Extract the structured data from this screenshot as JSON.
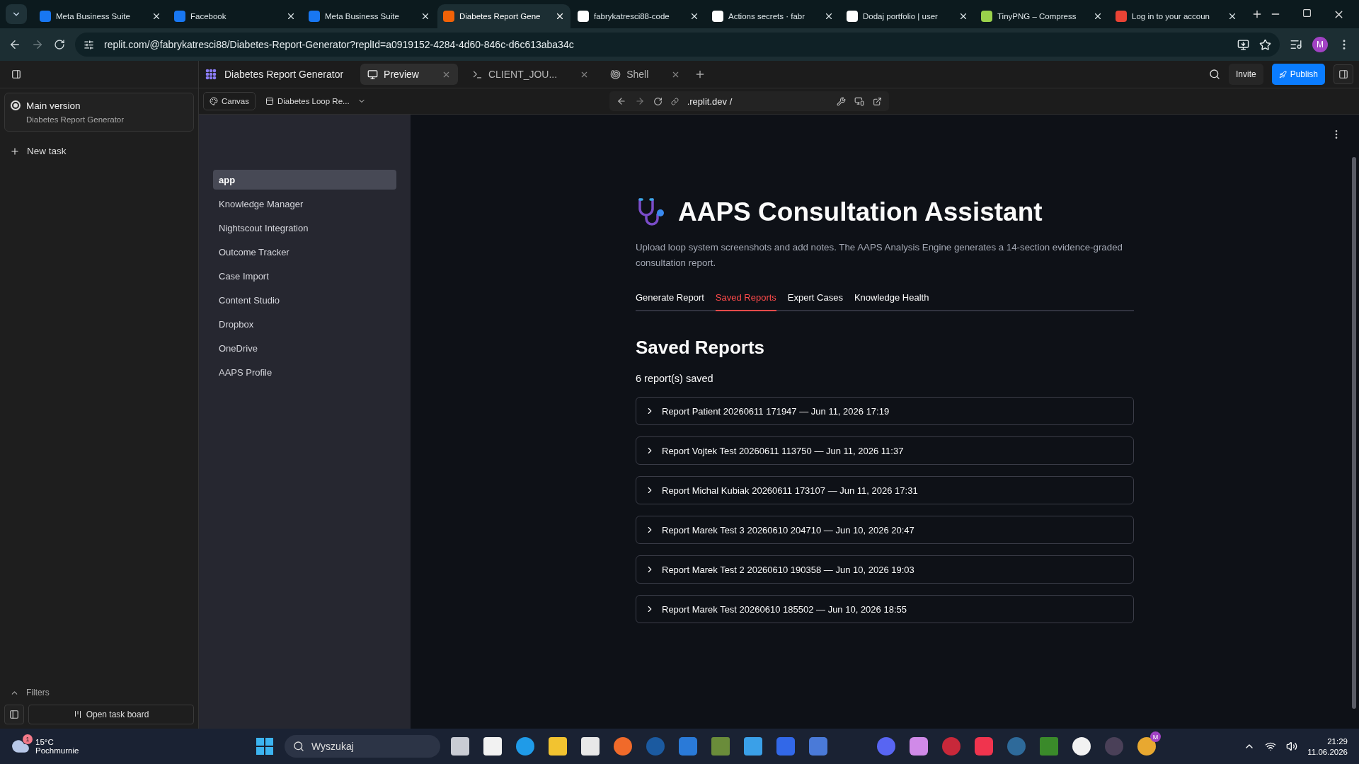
{
  "browser": {
    "tabs": [
      {
        "title": "Meta Business Suite",
        "selected": false
      },
      {
        "title": "Facebook",
        "selected": false
      },
      {
        "title": "Meta Business Suite",
        "selected": false
      },
      {
        "title": "Diabetes Report Gene",
        "selected": true
      },
      {
        "title": "fabrykatresci88-code",
        "selected": false
      },
      {
        "title": "Actions secrets · fabr",
        "selected": false
      },
      {
        "title": "Dodaj portfolio | user",
        "selected": false
      },
      {
        "title": "TinyPNG – Compress",
        "selected": false
      },
      {
        "title": "Log in to your accoun",
        "selected": false
      }
    ],
    "url": "replit.com/@fabrykatresci88/Diabetes-Report-Generator?replId=a0919152-4284-4d60-846c-d6c613aba34c",
    "profile": "M"
  },
  "replit": {
    "project": "Diabetes Report Generator",
    "tabs": [
      {
        "label": "Preview",
        "selected": true
      },
      {
        "label": "CLIENT_JOU...",
        "selected": false
      },
      {
        "label": "Shell",
        "selected": false
      }
    ],
    "invite": "Invite",
    "publish": "Publish",
    "canvas": "Canvas",
    "workflow": "Diabetes Loop Re...",
    "preview_url": ".replit.dev /",
    "version": {
      "title": "Main version",
      "subtitle": "Diabetes Report Generator"
    },
    "new_task": "New task",
    "filters": "Filters",
    "task_board": "Open task board"
  },
  "sidebar": {
    "items": [
      {
        "label": "app",
        "selected": true
      },
      {
        "label": "Knowledge Manager",
        "selected": false
      },
      {
        "label": "Nightscout Integration",
        "selected": false
      },
      {
        "label": "Outcome Tracker",
        "selected": false
      },
      {
        "label": "Case Import",
        "selected": false
      },
      {
        "label": "Content Studio",
        "selected": false
      },
      {
        "label": "Dropbox",
        "selected": false
      },
      {
        "label": "OneDrive",
        "selected": false
      },
      {
        "label": "AAPS Profile",
        "selected": false
      }
    ]
  },
  "app": {
    "title": "AAPS Consultation Assistant",
    "description": "Upload loop system screenshots and add notes. The AAPS Analysis Engine generates a 14-section evidence-graded consultation report.",
    "tabs": [
      {
        "label": "Generate Report",
        "selected": false
      },
      {
        "label": "Saved Reports",
        "selected": true
      },
      {
        "label": "Expert Cases",
        "selected": false
      },
      {
        "label": "Knowledge Health",
        "selected": false
      }
    ],
    "heading": "Saved Reports",
    "count": "6 report(s) saved",
    "reports": [
      {
        "label": "Report Patient 20260611 171947 — Jun 11, 2026 17:19",
        "expanded": false
      },
      {
        "label": "Report Vojtek Test 20260611 113750 — Jun 11, 2026 11:37",
        "expanded": false
      },
      {
        "label": "Report Michal Kubiak 20260611 173107 — Jun 11, 2026 17:31",
        "expanded": false
      },
      {
        "label": "Report Marek Test 3 20260610 204710 — Jun 10, 2026 20:47",
        "expanded": false
      },
      {
        "label": "Report Marek Test 2 20260610 190358 — Jun 10, 2026 19:03",
        "expanded": false
      },
      {
        "label": "Report Marek Test 20260610 185502 — Jun 10, 2026 18:55",
        "expanded": false
      }
    ]
  },
  "taskbar": {
    "weather": {
      "badge": "1",
      "temp": "15°C",
      "condition": "Pochmurnie"
    },
    "search": {
      "placeholder": "Wyszukaj"
    },
    "chrome_badge": "M",
    "time": "21:29",
    "date": "11.06.2026"
  }
}
